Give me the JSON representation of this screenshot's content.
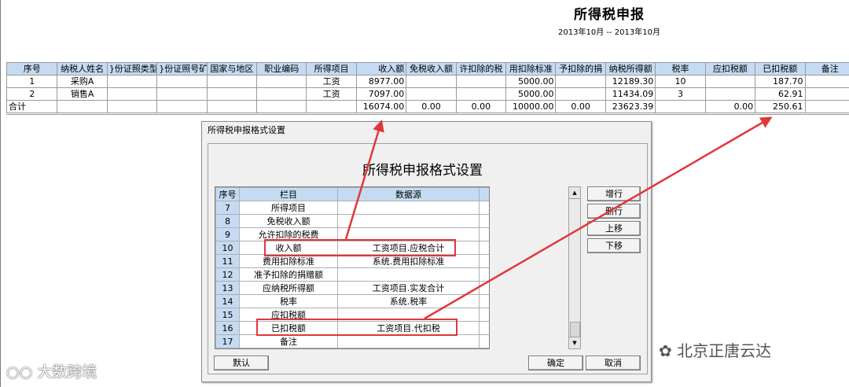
{
  "report": {
    "title": "所得税申报",
    "period": "2013年10月 -- 2013年10月",
    "headers": [
      "序号",
      "纳税人姓名",
      "身份证照类型",
      "身份证照号码",
      "国家与地区",
      "职业编码",
      "所得项目",
      "收入额",
      "免税收入额",
      "允许扣除的税费",
      "费用扣除标准",
      "准予扣除的捐赠额",
      "应纳税所得额",
      "税率",
      "应扣税额",
      "已扣税额",
      "备注"
    ],
    "headers_visible": [
      "序号",
      "纳税人姓名",
      "}份证照类型",
      "}份证照号矿",
      "国家与地区",
      "职业编码",
      "所得项目",
      "收入额",
      "免税收入额",
      "许扣除的税",
      "用扣除标准",
      "予扣除的捐",
      "纳税所得额",
      "税率",
      "应扣税额",
      "已扣税额",
      "备注"
    ],
    "rows": [
      [
        "1",
        "采购A",
        "",
        "",
        "",
        "",
        "工资",
        "8977.00",
        "",
        "",
        "5000.00",
        "",
        "12189.30",
        "10",
        "",
        "187.70",
        ""
      ],
      [
        "2",
        "销售A",
        "",
        "",
        "",
        "",
        "工资",
        "7097.00",
        "",
        "",
        "5000.00",
        "",
        "11434.09",
        "3",
        "",
        "62.91",
        ""
      ]
    ],
    "total": [
      "合计",
      "",
      "",
      "",
      "",
      "",
      "",
      "16074.00",
      "0.00",
      "0.00",
      "10000.00",
      "0.00",
      "23623.39",
      "",
      "0.00",
      "250.61",
      ""
    ]
  },
  "dialog": {
    "window_title": "所得税申报格式设置",
    "heading": "所得税申报格式设置",
    "columns": [
      "序号",
      "栏目",
      "数据源"
    ],
    "rows": [
      {
        "seq": "7",
        "field": "所得项目",
        "source": ""
      },
      {
        "seq": "8",
        "field": "免税收入额",
        "source": ""
      },
      {
        "seq": "9",
        "field": "允许扣除的税费",
        "source": ""
      },
      {
        "seq": "10",
        "field": "收入额",
        "source": "工资项目.应税合计"
      },
      {
        "seq": "11",
        "field": "费用扣除标准",
        "source": "系统.费用扣除标准"
      },
      {
        "seq": "12",
        "field": "准予扣除的捐赠额",
        "source": ""
      },
      {
        "seq": "13",
        "field": "应纳税所得额",
        "source": "工资项目.实发合计"
      },
      {
        "seq": "14",
        "field": "税率",
        "source": "系统.税率"
      },
      {
        "seq": "15",
        "field": "应扣税额",
        "source": ""
      },
      {
        "seq": "16",
        "field": "已扣税额",
        "source": "工资项目.代扣税"
      },
      {
        "seq": "17",
        "field": "备注",
        "source": ""
      }
    ],
    "buttons": {
      "add_row": "增行",
      "delete_row": "删行",
      "move_up": "上移",
      "move_down": "下移",
      "default": "默认",
      "ok": "确定",
      "cancel": "取消"
    }
  },
  "watermarks": {
    "right": "北京正唐云达",
    "left": "大数跨境"
  },
  "colors": {
    "header_bg": "#c5dbf3",
    "highlight": "#e0373b"
  }
}
